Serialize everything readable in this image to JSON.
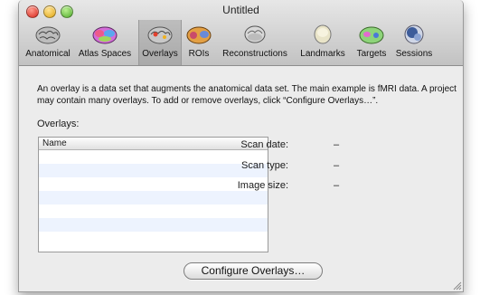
{
  "window": {
    "title": "Untitled"
  },
  "toolbar": {
    "items": [
      {
        "label": "Anatomical",
        "icon": "brain-gray-icon",
        "selected": false
      },
      {
        "label": "Atlas Spaces",
        "icon": "brain-colored-icon",
        "selected": false
      },
      {
        "label": "Overlays",
        "icon": "brain-overlay-icon",
        "selected": true
      },
      {
        "label": "ROIs",
        "icon": "brain-rois-icon",
        "selected": false
      },
      {
        "label": "Reconstructions",
        "icon": "brain-reconstruction-icon",
        "selected": false
      },
      {
        "label": "Landmarks",
        "icon": "head-landmarks-icon",
        "selected": false
      },
      {
        "label": "Targets",
        "icon": "brain-targets-icon",
        "selected": false
      },
      {
        "label": "Sessions",
        "icon": "head-sessions-icon",
        "selected": false
      }
    ]
  },
  "content": {
    "description": "An overlay is a data set that augments the anatomical data set. The main example is fMRI data. A project may contain many overlays. To add or remove overlays, click “Configure Overlays…”.",
    "section_label": "Overlays:",
    "table": {
      "column_header": "Name",
      "rows": []
    },
    "info": {
      "scan_date_label": "Scan date:",
      "scan_date_value": "–",
      "scan_type_label": "Scan type:",
      "scan_type_value": "–",
      "image_size_label": "Image size:",
      "image_size_value": "–"
    },
    "configure_button": "Configure Overlays…"
  },
  "colors": {
    "row_alt": "#edf3fe",
    "selected_tool": "#a9a9a9"
  }
}
